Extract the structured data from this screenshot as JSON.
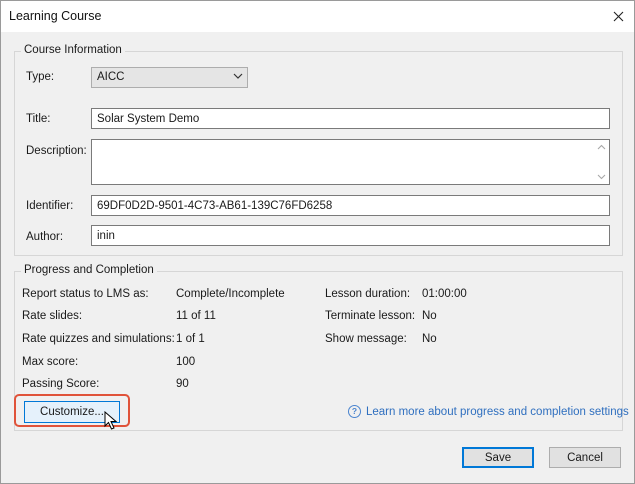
{
  "window": {
    "title": "Learning Course",
    "close_glyph": "✕"
  },
  "course_info": {
    "legend": "Course Information",
    "type_label": "Type:",
    "type_value": "AICC",
    "title_label": "Title:",
    "title_value": "Solar System Demo",
    "description_label": "Description:",
    "description_value": "",
    "identifier_label": "Identifier:",
    "identifier_value": "69DF0D2D-9501-4C73-AB61-139C76FD6258",
    "author_label": "Author:",
    "author_value": "inin"
  },
  "progress": {
    "legend": "Progress and Completion",
    "left": [
      {
        "label": "Report status to LMS as:",
        "value": "Complete/Incomplete"
      },
      {
        "label": "Rate slides:",
        "value": "11 of 11"
      },
      {
        "label": "Rate quizzes and simulations:",
        "value": "1 of 1"
      },
      {
        "label": "Max score:",
        "value": "100"
      },
      {
        "label": "Passing Score:",
        "value": "90"
      }
    ],
    "right": [
      {
        "label": "Lesson duration:",
        "value": "01:00:00"
      },
      {
        "label": "Terminate lesson:",
        "value": "No"
      },
      {
        "label": "Show message:",
        "value": "No"
      }
    ],
    "customize_label": "Customize...",
    "help_glyph": "?",
    "learn_more_link": "Learn more about progress and completion settings"
  },
  "footer": {
    "save_label": "Save",
    "cancel_label": "Cancel"
  },
  "colors": {
    "accent": "#0078d7",
    "highlight": "#e0533a",
    "link": "#2f6fbf"
  },
  "icons": [
    "close-icon",
    "chevron-down-icon",
    "scroll-up-icon",
    "scroll-down-icon",
    "help-icon",
    "mouse-cursor-icon"
  ]
}
